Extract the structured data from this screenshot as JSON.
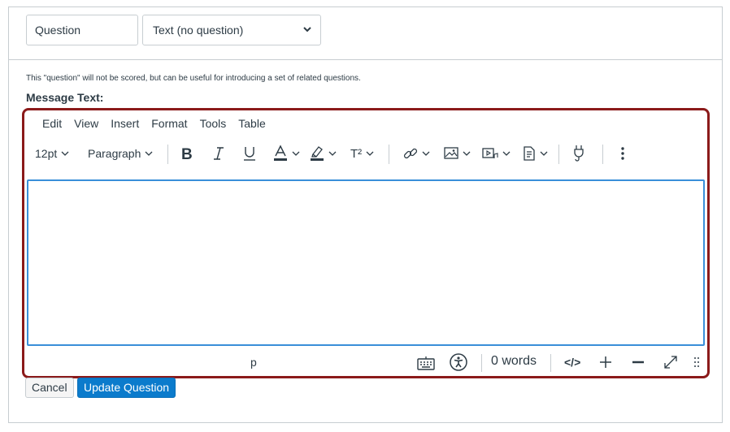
{
  "question": {
    "name_value": "Question",
    "type_value": "Text (no question)",
    "note": "This \"question\" will not be scored, but can be useful for introducing a set of related questions.",
    "message_label": "Message Text:"
  },
  "editor": {
    "menu": [
      "Edit",
      "View",
      "Insert",
      "Format",
      "Tools",
      "Table"
    ],
    "font_size": "12pt",
    "block_format": "Paragraph",
    "superscript_label": "T²",
    "content_text": "",
    "status_path": "p",
    "word_count": "0 words",
    "html_toggle_label": "</>"
  },
  "icons": {
    "bold": "bold-icon",
    "italic": "italic-icon",
    "underline": "underline-icon",
    "text_color": "text-color-icon",
    "highlight": "highlight-color-icon",
    "link": "link-icon",
    "image": "image-icon",
    "media": "media-icon",
    "document": "document-icon",
    "apps": "plug-icon",
    "more": "more-vertical-icon",
    "keyboard": "keyboard-icon",
    "accessibility": "accessibility-icon",
    "fullscreen": "expand-icon",
    "resize": "resize-grip-icon"
  },
  "colors": {
    "highlight_border": "#8b1a1a",
    "focus_border": "#3a8fd9",
    "primary_button": "#0b7bcc",
    "text": "#2d3b45"
  },
  "buttons": {
    "cancel": "Cancel",
    "update": "Update Question"
  }
}
